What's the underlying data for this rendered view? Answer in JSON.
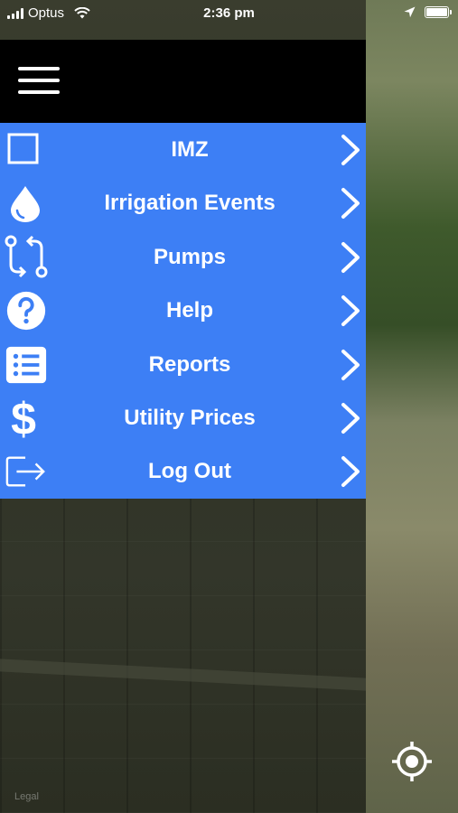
{
  "status_bar": {
    "carrier": "Optus",
    "time": "2:36 pm"
  },
  "menu": {
    "items": [
      {
        "label": "IMZ",
        "icon": "square-icon"
      },
      {
        "label": "Irrigation Events",
        "icon": "water-drop-icon"
      },
      {
        "label": "Pumps",
        "icon": "sync-arrows-icon"
      },
      {
        "label": "Help",
        "icon": "question-circle-icon"
      },
      {
        "label": "Reports",
        "icon": "list-icon"
      },
      {
        "label": "Utility Prices",
        "icon": "dollar-icon"
      },
      {
        "label": "Log Out",
        "icon": "logout-icon"
      }
    ]
  },
  "map": {
    "legal": "Legal"
  },
  "colors": {
    "menu_background": "#3d7ff5",
    "header_background": "#000000",
    "text": "#ffffff"
  }
}
